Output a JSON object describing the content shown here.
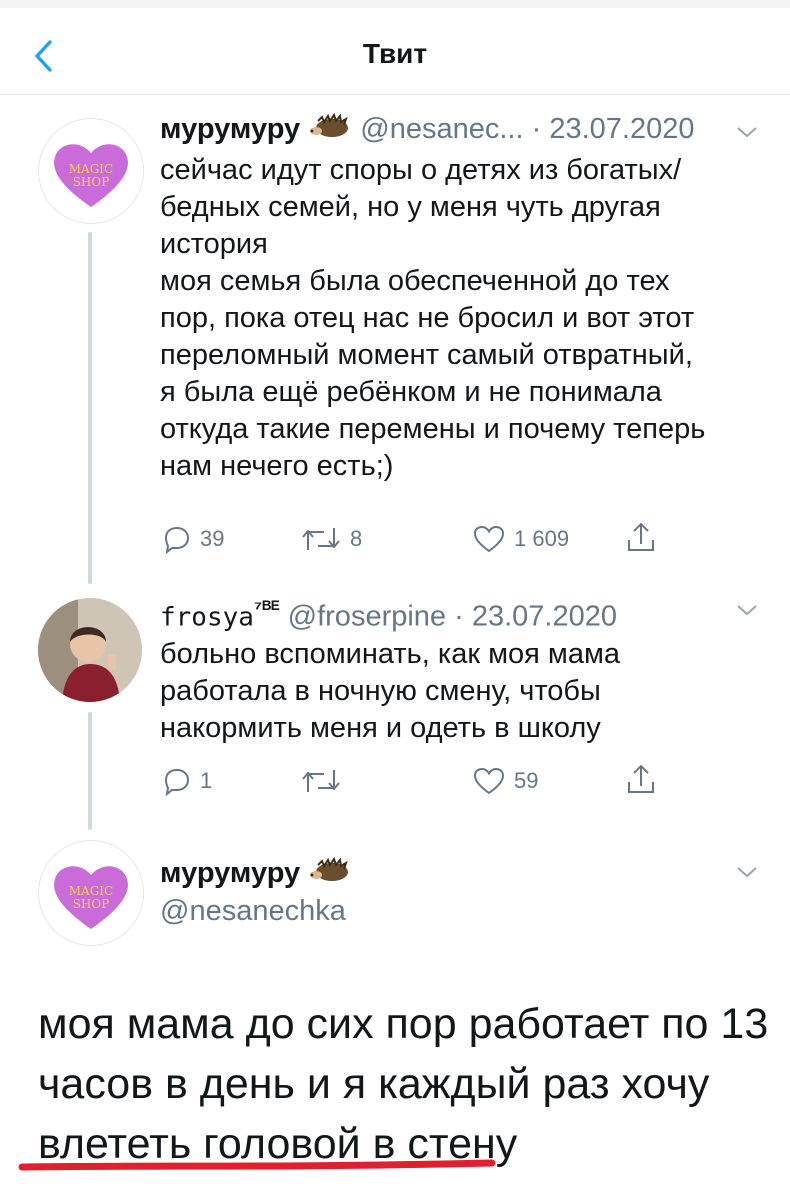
{
  "header": {
    "title": "Твит"
  },
  "tweets": [
    {
      "name": "мурумуру",
      "handle": "@nesanec...",
      "date": "· 23.07.2020",
      "avatar_text": [
        "MAGIC",
        "SHOP"
      ],
      "lines": [
        "сейчас идут споры о детях из богатых/",
        "бедных семей, но у меня чуть другая",
        "история",
        "моя семья была обеспеченной до тех",
        "пор, пока отец нас не бросил и вот этот",
        "переломный момент самый отвратный,",
        "я была ещё ребёнком и не понимала",
        "откуда такие перемены и почему теперь",
        "нам нечего есть;)"
      ],
      "actions": {
        "replies": "39",
        "retweets": "8",
        "likes": "1 609"
      }
    },
    {
      "name": "frosya",
      "name_suffix": "⁷ᴮᴱ",
      "handle": "@froserpine",
      "date": "· 23.07.2020",
      "lines": [
        "больно вспоминать, как  моя мама",
        "работала в ночную смену, чтобы",
        "накормить меня и одеть в школу"
      ],
      "actions": {
        "replies": "1",
        "retweets": "",
        "likes": "59"
      }
    }
  ],
  "main_tweet": {
    "name": "мурумуру",
    "handle": "@nesanechka",
    "avatar_text": [
      "MAGIC",
      "SHOP"
    ],
    "lines": [
      "моя мама до сих пор работает по 13",
      "часов в день и я каждый раз хочу",
      "влететь головой в стену"
    ]
  },
  "colors": {
    "accent": "#1da1f2",
    "muted": "#657786",
    "underline": "#e0202c",
    "heart": "#c96bd8"
  }
}
